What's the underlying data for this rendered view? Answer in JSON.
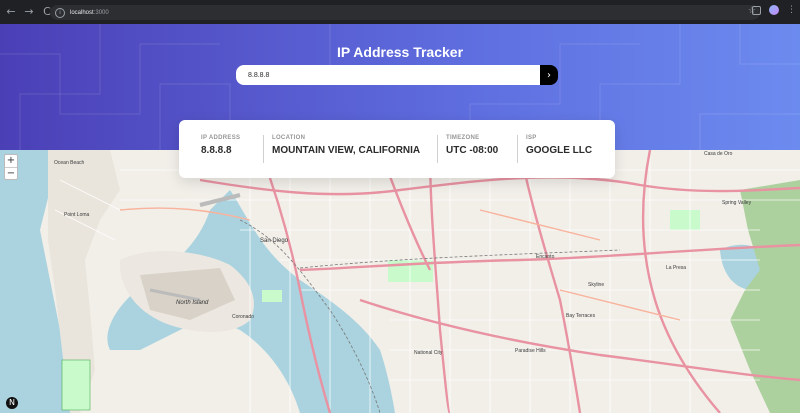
{
  "browser": {
    "nav_back": "←",
    "nav_forward": "→",
    "nav_reload": "C",
    "url_host": "localhost",
    "url_port": ":3000",
    "star_icon": "☆",
    "kebab_icon": "⋮"
  },
  "header": {
    "title": "IP Address Tracker"
  },
  "search": {
    "value": "8.8.8.8",
    "button_icon": "›"
  },
  "info": {
    "ip": {
      "label": "IP ADDRESS",
      "value": "8.8.8.8"
    },
    "location": {
      "label": "LOCATION",
      "value": "MOUNTAIN VIEW, CALIFORNIA"
    },
    "timezone": {
      "label": "TIMEZONE",
      "value": "UTC -08:00"
    },
    "isp": {
      "label": "ISP",
      "value": "GOOGLE LLC"
    }
  },
  "map": {
    "zoom_in": "+",
    "zoom_out": "−",
    "places": {
      "ocean_beach": "Ocean Beach",
      "point_loma": "Point Loma",
      "san_diego": "San Diego",
      "north_island": "North Island",
      "coronado": "Coronado",
      "national_city": "National City",
      "paradise_hills": "Paradise Hills",
      "bay_terraces": "Bay Terraces",
      "encanto": "Encanto",
      "skyline": "Skyline",
      "la_presa": "La Presa",
      "spring_valley": "Spring Valley",
      "casa_de_oro": "Casa de Oro"
    }
  },
  "dev_badge": "N",
  "colors": {
    "hero_start": "#4b3fb6",
    "hero_end": "#6c8bef",
    "water": "#aad3df",
    "land": "#f2efe9",
    "highway": "#e892a2"
  }
}
